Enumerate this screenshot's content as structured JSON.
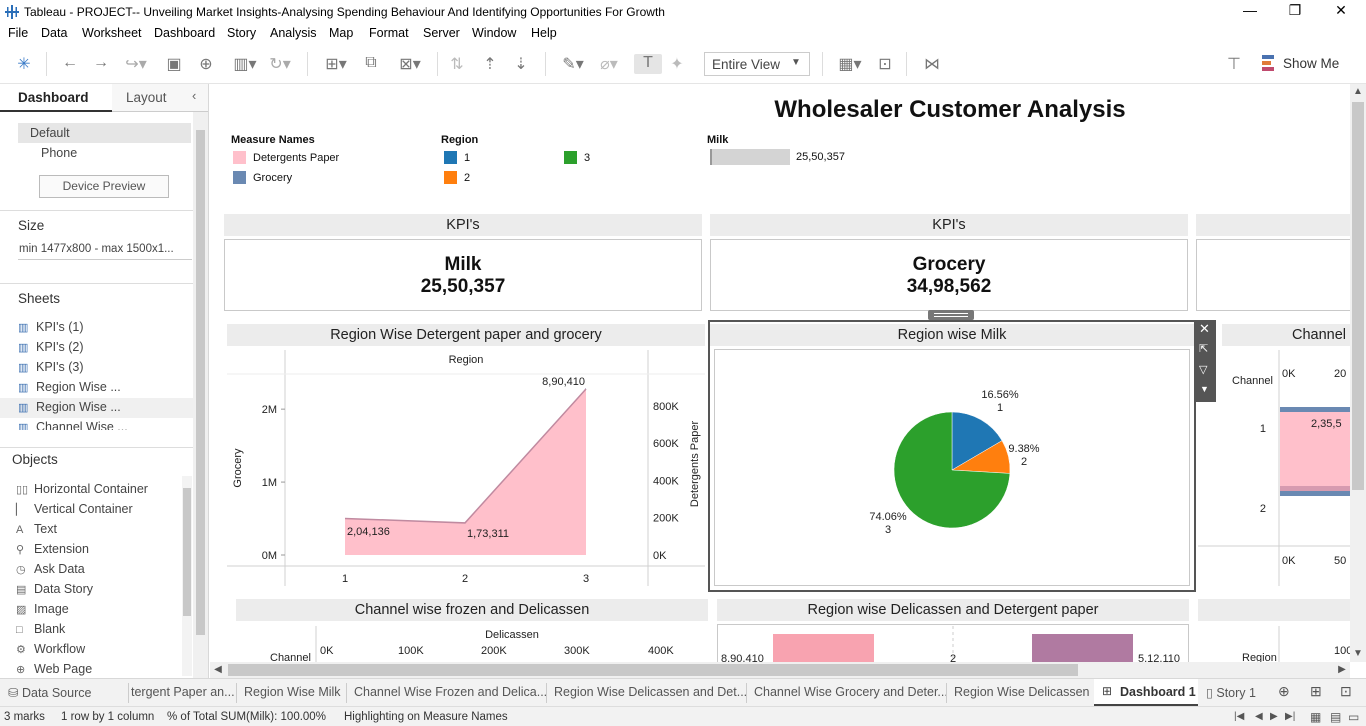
{
  "window": {
    "title": "Tableau - PROJECT-- Unveiling Market Insights-Analysing Spending Behaviour And Identifying Opportunities For Growth",
    "minimize": "—",
    "restore": "❐",
    "close": "✕"
  },
  "menu": [
    "File",
    "Data",
    "Worksheet",
    "Dashboard",
    "Story",
    "Analysis",
    "Map",
    "Format",
    "Server",
    "Window",
    "Help"
  ],
  "toolbar": {
    "fit_label": "Entire View",
    "show_me": "Show Me"
  },
  "left_pane": {
    "tab_dashboard": "Dashboard",
    "tab_layout": "Layout",
    "device_default": "Default",
    "device_phone": "Phone",
    "device_preview": "Device Preview",
    "size_label": "Size",
    "size_value": "min 1477x800 - max 1500x1...",
    "sheets_label": "Sheets",
    "sheets": [
      "KPI's (1)",
      "KPI's (2)",
      "KPI's (3)",
      "Region Wise ...",
      "Region Wise ...",
      "Channel Wise ..."
    ],
    "objects_label": "Objects",
    "objects": [
      {
        "icon": "horizontal-container-icon",
        "glyph": "▯▯",
        "label": "Horizontal Container"
      },
      {
        "icon": "vertical-container-icon",
        "glyph": "▏",
        "label": "Vertical Container"
      },
      {
        "icon": "text-icon",
        "glyph": "A",
        "label": "Text"
      },
      {
        "icon": "extension-icon",
        "glyph": "⚲",
        "label": "Extension"
      },
      {
        "icon": "ask-data-icon",
        "glyph": "◷",
        "label": "Ask Data"
      },
      {
        "icon": "data-story-icon",
        "glyph": "▤",
        "label": "Data Story"
      },
      {
        "icon": "image-icon",
        "glyph": "▨",
        "label": "Image"
      },
      {
        "icon": "blank-icon",
        "glyph": "□",
        "label": "Blank"
      },
      {
        "icon": "workflow-icon",
        "glyph": "⚙",
        "label": "Workflow"
      },
      {
        "icon": "web-page-icon",
        "glyph": "⊕",
        "label": "Web Page"
      }
    ]
  },
  "dashboard": {
    "title": "Wholesaler Customer Analysis",
    "legend_measure": {
      "title": "Measure Names",
      "items": [
        {
          "label": "Detergents Paper",
          "color": "#FFC0CB"
        },
        {
          "label": "Grocery",
          "color": "#6A89B2"
        }
      ]
    },
    "legend_region": {
      "title": "Region",
      "items": [
        {
          "label": "1",
          "color": "#1F77B4"
        },
        {
          "label": "2",
          "color": "#FF7F0E"
        },
        {
          "label": "3",
          "color": "#2CA02C"
        }
      ]
    },
    "legend_milk": {
      "title": "Milk",
      "value": "25,50,357",
      "fill": 1.0
    },
    "kpi1": {
      "header": "KPI's",
      "name": "Milk",
      "value": "25,50,357"
    },
    "kpi2": {
      "header": "KPI's",
      "name": "Grocery",
      "value": "34,98,562"
    },
    "sheet_region_det_groc": {
      "title": "Region Wise Detergent paper and grocery",
      "col_header": "Region"
    },
    "sheet_region_milk": {
      "title": "Region wise Milk"
    },
    "sheet_channel_partial": {
      "title": "Channel",
      "row_header": "Channel"
    },
    "sheet_frozen_deli": {
      "title": "Channel wise frozen and Delicassen",
      "col_header": "Delicassen",
      "row_header": "Channel",
      "ticks": [
        "0K",
        "100K",
        "200K",
        "300K",
        "400K"
      ]
    },
    "sheet_deli_det": {
      "title": "Region wise Delicassen and Detergent paper",
      "left_label": "8,90,410",
      "mid_label": "2",
      "right_label": "5,12,110"
    },
    "sheet_partial_bottom": {
      "row_header": "Region",
      "tick": "100"
    }
  },
  "chart_data": [
    {
      "type": "area",
      "title": "Region Wise Detergent paper and grocery",
      "xlabel": "Region",
      "categories": [
        "1",
        "2",
        "3"
      ],
      "series": [
        {
          "name": "Grocery",
          "axis": "left",
          "values": [
            204136,
            173311,
            2290000
          ]
        },
        {
          "name": "Detergents Paper",
          "axis": "right",
          "values": [
            196000,
            172000,
            890410
          ]
        }
      ],
      "data_labels": [
        "2,04,136",
        "1,73,311",
        "8,90,410"
      ],
      "left_axis": {
        "label": "Grocery",
        "ticks": [
          "0M",
          "1M",
          "2M"
        ],
        "ylim": [
          0,
          2290000
        ]
      },
      "right_axis": {
        "label": "Detergents Paper",
        "ticks": [
          "0K",
          "200K",
          "400K",
          "600K",
          "800K"
        ],
        "ylim": [
          0,
          890410
        ]
      }
    },
    {
      "type": "pie",
      "title": "Region wise Milk",
      "slices": [
        {
          "label": "1",
          "percent": 16.56,
          "text": "16.56%",
          "color": "#1F77B4"
        },
        {
          "label": "2",
          "percent": 9.38,
          "text": "9.38%",
          "color": "#FF7F0E"
        },
        {
          "label": "3",
          "percent": 74.06,
          "text": "74.06%",
          "color": "#2CA02C"
        }
      ]
    },
    {
      "type": "bar",
      "title": "Channel",
      "categories": [
        "1",
        "2"
      ],
      "ticks_top": [
        "0K",
        "20"
      ],
      "ticks_bottom": [
        "0K",
        "50"
      ],
      "data_labels": [
        "2,35,5"
      ]
    }
  ],
  "tabs": {
    "data_source": "Data Source",
    "sheets": [
      "tergent Paper an...",
      "Region Wise Milk",
      "Channel Wise Frozen and Delica...",
      "Region Wise Delicassen and Det...",
      "Channel Wise Grocery and Deter...",
      "Region Wise Delicassen"
    ],
    "active": "Dashboard 1",
    "story": "Story 1"
  },
  "status": {
    "marks": "3 marks",
    "rows": "1 row by 1 column",
    "pct": "% of Total SUM(Milk): 100.00%",
    "highlight": "Highlighting on Measure Names"
  }
}
